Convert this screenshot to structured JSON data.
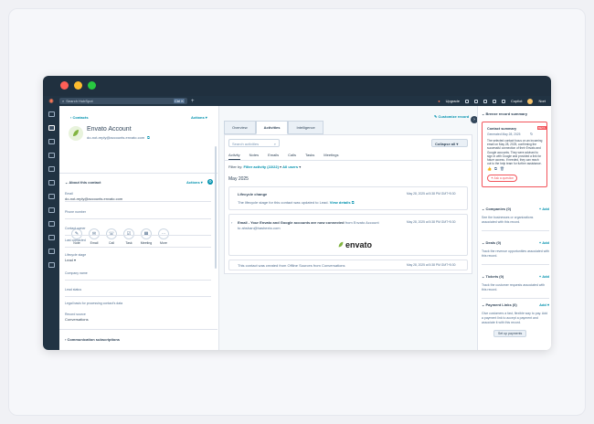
{
  "topbar": {
    "search_placeholder": "Search HubSpot",
    "shortcut": "Ctrl K",
    "upgrade": "Upgrade",
    "copilot": "Copilot",
    "account": "Nort"
  },
  "left": {
    "back_link": "Contacts",
    "actions": "Actions",
    "name": "Envato Account",
    "email": "do-not-reply@accounts.envato.com",
    "quick_actions": [
      "Note",
      "Email",
      "Call",
      "Task",
      "Meeting",
      "More"
    ],
    "about_title": "About this contact",
    "about_actions": "Actions",
    "fields": [
      {
        "label": "Email",
        "value": "do-not-reply@accounts.envato.com"
      },
      {
        "label": "Phone number",
        "value": ""
      },
      {
        "label": "Contact owner",
        "value": ""
      },
      {
        "label": "Last contacted",
        "value": ""
      },
      {
        "label": "Lifecycle stage",
        "value": "Lead"
      },
      {
        "label": "Company name",
        "value": ""
      },
      {
        "label": "Lead status",
        "value": ""
      },
      {
        "label": "Legal basis for processing contact's data",
        "value": ""
      },
      {
        "label": "Record source",
        "value": "Conversations"
      }
    ],
    "subscriptions": "Communication subscriptions"
  },
  "mid": {
    "customize": "Customize record",
    "main_tabs": [
      "Overview",
      "Activities",
      "Intelligence"
    ],
    "search_placeholder": "Search activities",
    "collapse": "Collapse all",
    "sub_tabs": [
      "Activity",
      "Notes",
      "Emails",
      "Calls",
      "Tasks",
      "Meetings"
    ],
    "filter_label": "Filter by:",
    "filter_activity": "Filter activity (22/22)",
    "filter_users": "All users",
    "month": "May 2025",
    "items": [
      {
        "title": "Lifecycle change",
        "date": "May 28, 2025 at 5:38 PM GMT+5:30",
        "body": "The lifecycle stage for this contact was updated to Lead.",
        "link": "View details"
      },
      {
        "title": "Email - Your Envato and Google accounts are now connected",
        "from": "from Envato Account",
        "to": "to ahshan@hashexto.com",
        "date": "May 28, 2025 at 5:38 PM GMT+5:30",
        "brand": "envato"
      },
      {
        "body": "This contact was created from Offline Sources from Conversations",
        "date": "May 28, 2025 at 5:38 PM GMT+5:30"
      }
    ]
  },
  "right": {
    "breeze_title": "Breeze record summary",
    "summary_title": "Contact summary",
    "summary_badge": "BETA",
    "generated": "Generated May 28, 2025",
    "summary_text": "The selected contact focus on an incoming email on May 28, 2025, confirming the successful connection of their Envato and Google accounts. They were advised to sign in with Google and provided a link for future access. If needed, they can reach out to the help team for further assistance.",
    "ask_button": "Ask a question",
    "sections": [
      {
        "title": "Companies (0)",
        "add": "+ Add",
        "text": "See the businesses or organizations associated with this record."
      },
      {
        "title": "Deals (0)",
        "add": "+ Add",
        "text": "Track the revenue opportunities associated with this record."
      },
      {
        "title": "Tickets (0)",
        "add": "+ Add",
        "text": "Track the customer requests associated with this record."
      },
      {
        "title": "Payment Links (0)",
        "add": "Add",
        "text": "Give customers a fast, flexible way to pay. Add a payment link to accept a payment and associate it with this record."
      }
    ],
    "setup_button": "Set up payments"
  },
  "colors": {
    "accent": "#0091ae",
    "nav": "#213343",
    "brand": "#ff7a59",
    "envato": "#82b541"
  }
}
